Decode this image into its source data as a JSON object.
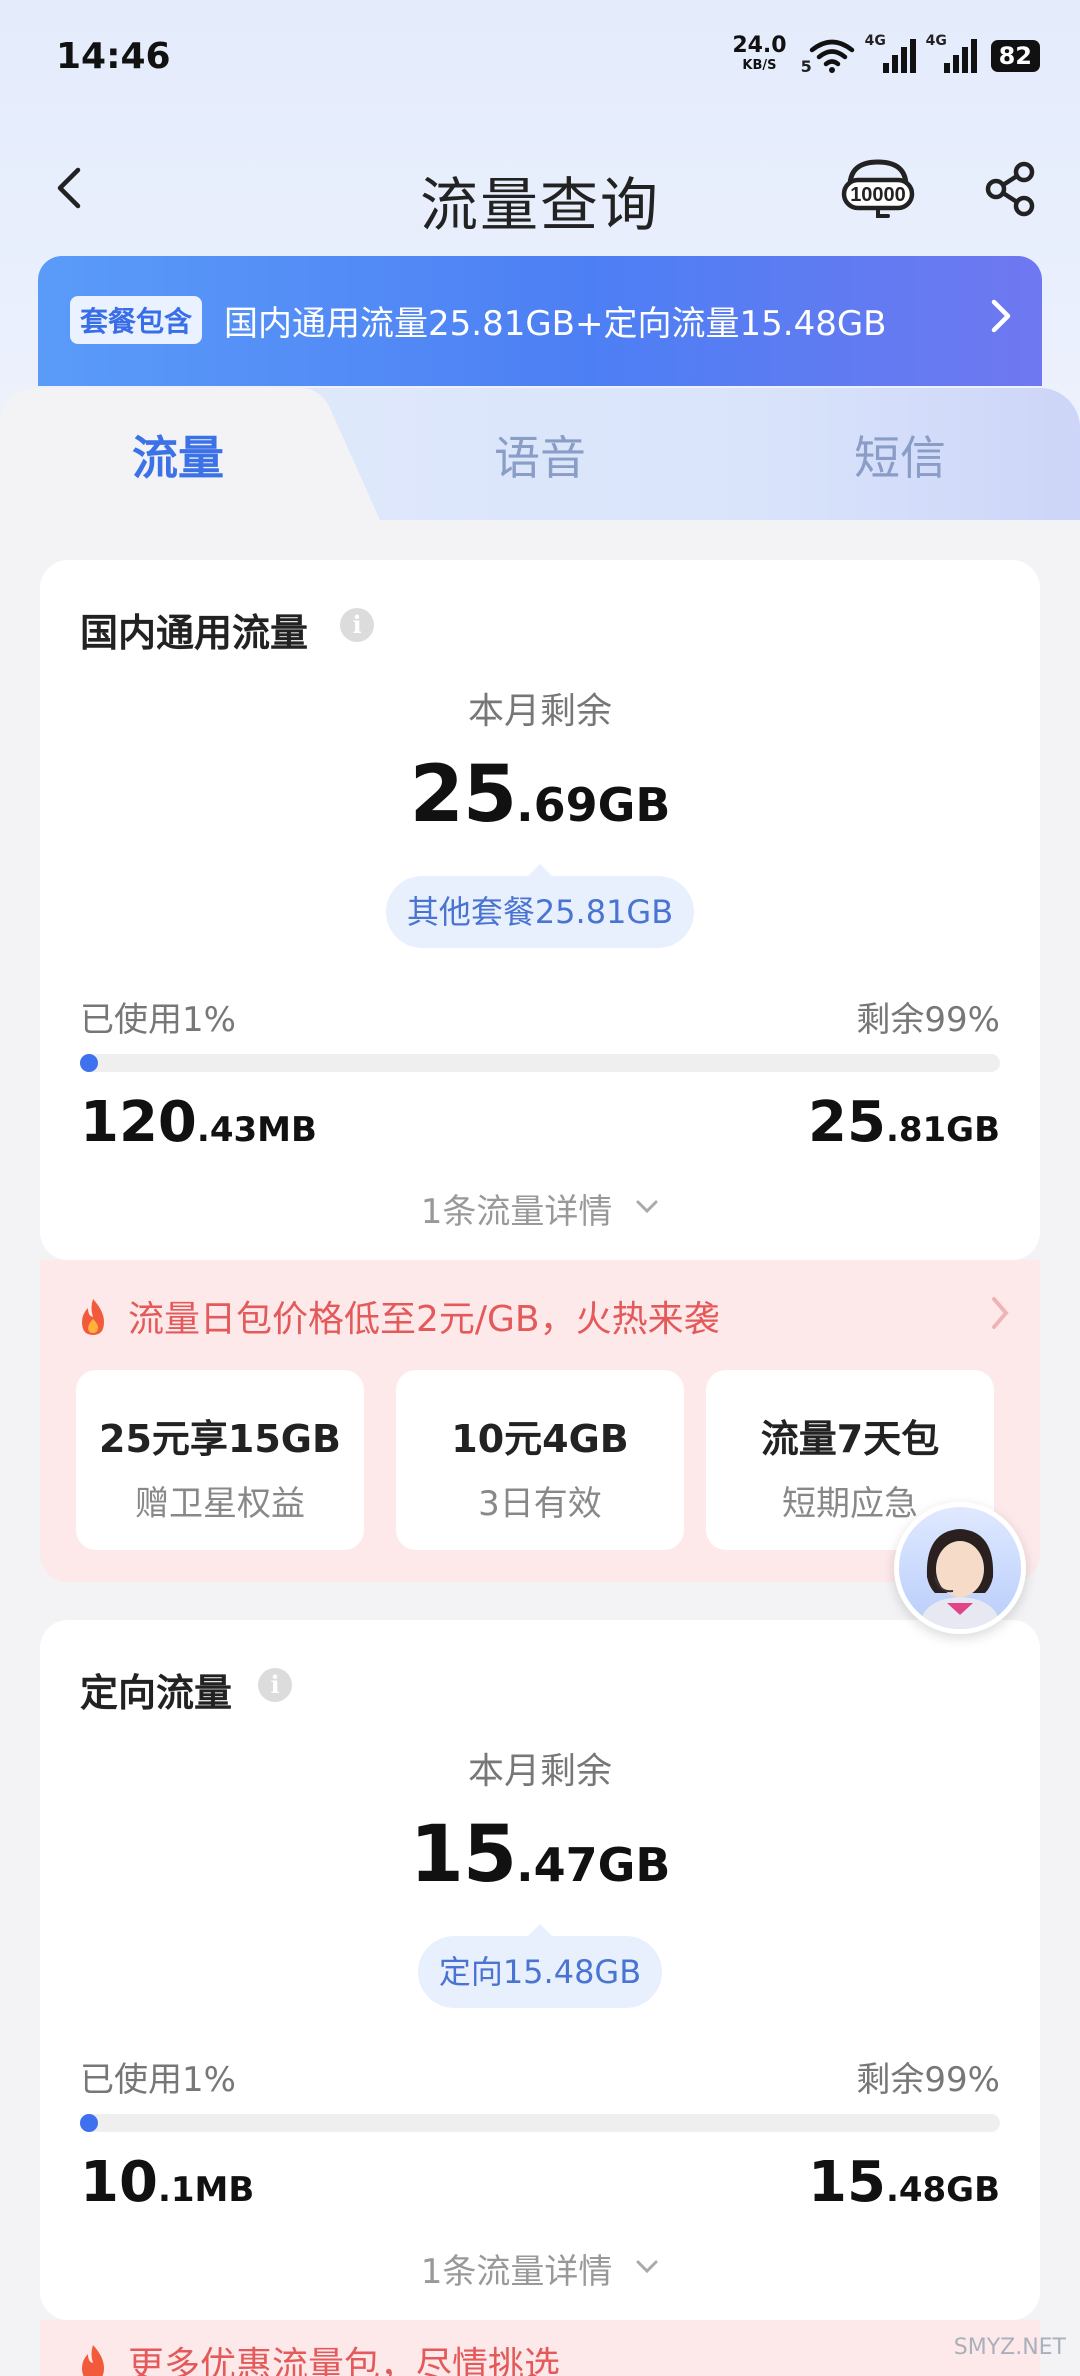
{
  "status_bar": {
    "time": "14:46",
    "speed_value": "24.0",
    "speed_unit": "KB/S",
    "wifi_label": "5",
    "network1": "4G",
    "network2": "4G",
    "battery": "82"
  },
  "nav": {
    "title": "流量查询",
    "hotline_label": "10000"
  },
  "package_banner": {
    "tag": "套餐包含",
    "text": "国内通用流量25.81GB+定向流量15.48GB"
  },
  "tabs": [
    {
      "label": "流量",
      "active": true
    },
    {
      "label": "语音",
      "active": false
    },
    {
      "label": "短信",
      "active": false
    }
  ],
  "general_data": {
    "title": "国内通用流量",
    "remain_label": "本月剩余",
    "remain_int": "25",
    "remain_dec": ".69GB",
    "pill": "其他套餐25.81GB",
    "used_label": "已使用1%",
    "left_label": "剩余99%",
    "used_fraction": 0.01,
    "used_int": "120",
    "used_dec": ".43MB",
    "left_int": "25",
    "left_dec": ".81GB",
    "detail": "1条流量详情"
  },
  "promo1": {
    "headline": "流量日包价格低至2元/GB，火热来袭",
    "offers": [
      {
        "title": "25元享15GB",
        "sub": "赠卫星权益"
      },
      {
        "title": "10元4GB",
        "sub": "3日有效"
      },
      {
        "title": "流量7天包",
        "sub": "短期应急"
      }
    ]
  },
  "directed_data": {
    "title": "定向流量",
    "remain_label": "本月剩余",
    "remain_int": "15",
    "remain_dec": ".47GB",
    "pill": "定向15.48GB",
    "used_label": "已使用1%",
    "left_label": "剩余99%",
    "used_fraction": 0.01,
    "used_int": "10",
    "used_dec": ".1MB",
    "left_int": "15",
    "left_dec": ".48GB",
    "detail": "1条流量详情"
  },
  "promo2": {
    "headline": "更多优惠流量包，尽情挑选"
  },
  "watermark": "SMYZ.NET",
  "colors": {
    "accent": "#3c72e8",
    "banner_start": "#5a9bf8",
    "banner_end": "#6f78f0",
    "promo_bg": "#fde9ea",
    "promo_text": "#e45a5a"
  }
}
